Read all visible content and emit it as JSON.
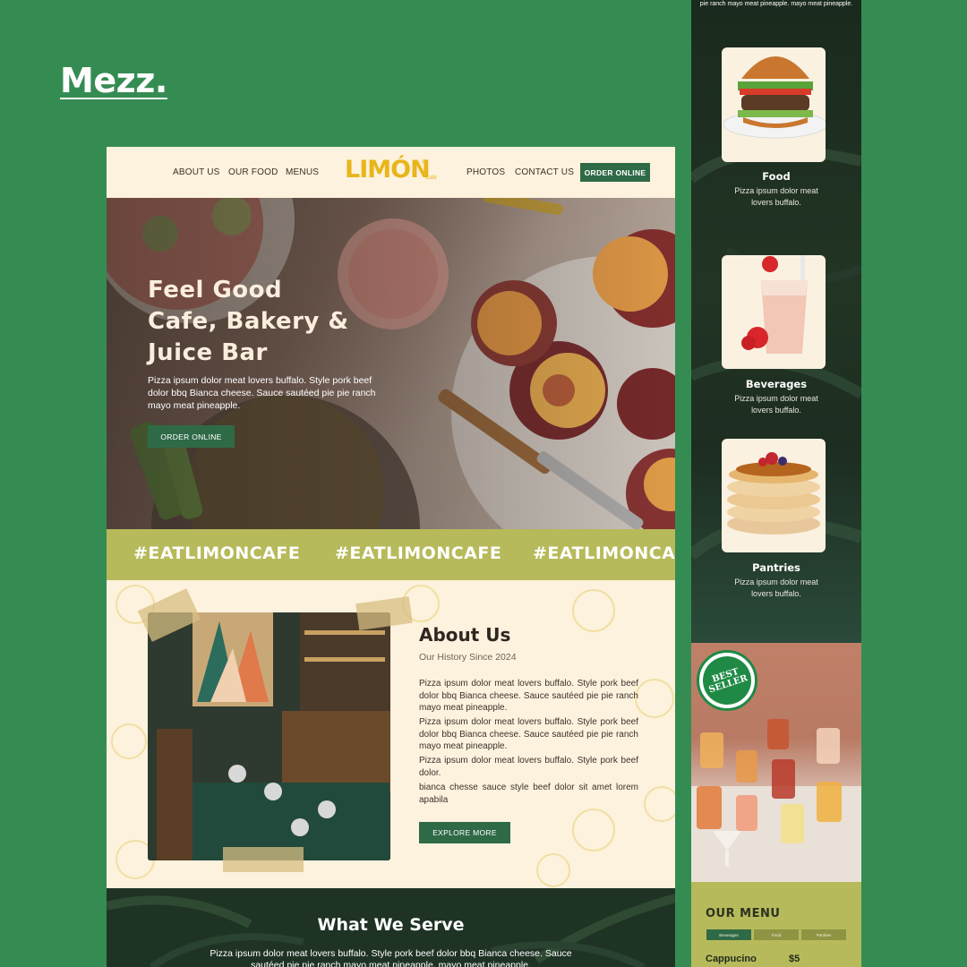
{
  "brand": "Mezz.",
  "site": {
    "nav": {
      "left_links": [
        "ABOUT US",
        "OUR FOOD",
        "MENUS"
      ],
      "right_links": [
        "PHOTOS",
        "CONTACT US"
      ],
      "logo": "LIMÓN",
      "logo_sub": "Café",
      "logo_reg": "®",
      "order_label": "ORDER ONLINE"
    },
    "hero": {
      "title": "Feel Good\nCafe, Bakery &\nJuice Bar",
      "text": "Pizza ipsum dolor meat lovers buffalo. Style pork beef dolor bbq Bianca cheese. Sauce sautéed pie pie ranch mayo meat pineapple.",
      "order_label": "ORDER ONLINE"
    },
    "hashtag_strip": [
      "#EATLIMONCAFE",
      "#EATLIMONCAFE",
      "#EATLIMONCAFE"
    ],
    "about": {
      "title": "About Us",
      "subtitle": "Our History Since 2024",
      "paragraphs": [
        "Pizza ipsum dolor meat lovers buffalo. Style pork beef dolor bbq Bianca cheese. Sauce sautéed pie pie ranch mayo meat pineapple.",
        "Pizza ipsum dolor meat lovers buffalo. Style pork beef dolor bbq Bianca cheese. Sauce sautéed pie pie ranch mayo meat pineapple.",
        "Pizza ipsum dolor meat lovers buffalo. Style pork beef dolor.",
        "bianca chesse sauce style beef dolor sit amet lorem apabila"
      ],
      "button_label": "EXPLORE MORE"
    },
    "serve": {
      "title": "What We Serve",
      "text": "Pizza ipsum dolor meat lovers buffalo. Style pork beef dolor bbq Bianca cheese. Sauce sautéed pie pie ranch mayo meat pineapple. mayo meat pineapple."
    }
  },
  "mobile": {
    "top_text": "pie ranch mayo meat pineapple. mayo meat pineapple.",
    "categories": [
      {
        "title": "Food",
        "text": "Pizza ipsum dolor meat lovers buffalo.",
        "icon": "burger-icon"
      },
      {
        "title": "Beverages",
        "text": "Pizza ipsum dolor meat lovers buffalo.",
        "icon": "milkshake-icon"
      },
      {
        "title": "Pantries",
        "text": "Pizza ipsum dolor meat lovers buffalo.",
        "icon": "pancakes-icon"
      }
    ],
    "badge": {
      "line1": "BEST",
      "line2": "SELLER"
    },
    "menu": {
      "title": "OUR MENU",
      "tabs": [
        "Beverages",
        "Food",
        "Pantries"
      ],
      "active_tab": "Beverages",
      "item": {
        "name": "Cappucino",
        "price": "$5"
      }
    }
  },
  "colors": {
    "page_bg": "#358c52",
    "primary_green": "#2f6a47",
    "logo_yellow": "#e8b51a",
    "olive_strip": "#b6ba5a",
    "cream": "#fdf2dd"
  }
}
